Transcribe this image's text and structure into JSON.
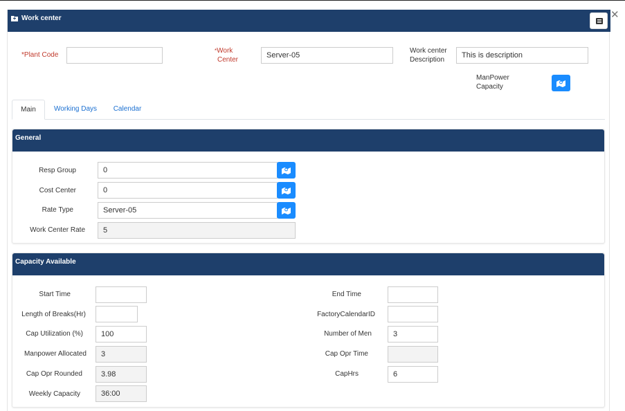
{
  "window": {
    "title": "Work center"
  },
  "header": {
    "plant_code": {
      "asterisk": "*",
      "label": "Plant Code",
      "value": ""
    },
    "work_center": {
      "asterisk": "*",
      "label_line1": "Work",
      "label_line2": "Center",
      "value": "Server-05"
    },
    "description": {
      "label_line1": "Work center",
      "label_line2": "Description",
      "value": "This is description"
    },
    "manpower": {
      "label_line1": "ManPower",
      "label_line2": "Capacity"
    }
  },
  "tabs": [
    {
      "label": "Main",
      "active": true
    },
    {
      "label": "Working Days",
      "active": false
    },
    {
      "label": "Calendar",
      "active": false
    }
  ],
  "general": {
    "title": "General",
    "resp_group": {
      "label": "Resp Group",
      "value": "0"
    },
    "cost_center": {
      "label": "Cost Center",
      "value": "0"
    },
    "rate_type": {
      "label": "Rate Type",
      "value": "Server-05"
    },
    "work_center_rate": {
      "label": "Work Center Rate",
      "value": "5"
    }
  },
  "capacity": {
    "title": "Capacity Available",
    "start_time": {
      "label": "Start Time",
      "value": ""
    },
    "length_of_breaks": {
      "label": "Length of Breaks(Hr)",
      "value": ""
    },
    "cap_utilization": {
      "label": "Cap Utilization (%)",
      "value": "100"
    },
    "manpower_allocated": {
      "label": "Manpower Allocated",
      "value": "3"
    },
    "cap_opr_rounded": {
      "label": "Cap Opr Rounded",
      "value": "3.98"
    },
    "weekly_capacity": {
      "label": "Weekly Capacity",
      "value": "36:00"
    },
    "end_time": {
      "label": "End Time",
      "value": ""
    },
    "factory_calendar_id": {
      "label": "FactoryCalendarID",
      "value": ""
    },
    "number_of_men": {
      "label": "Number of Men",
      "value": "3"
    },
    "cap_opr_time": {
      "label": "Cap Opr Time",
      "value": ""
    },
    "cap_hrs": {
      "label": "CapHrs",
      "value": "6"
    }
  },
  "colors": {
    "header_bg": "#1e3f6b",
    "accent_button": "#1a8cff",
    "required": "#c0392b",
    "link": "#1a6fd1"
  },
  "icons": {
    "title": "folder-icon",
    "menu": "list-icon",
    "close": "close-icon",
    "picker": "map-marker-icon"
  }
}
